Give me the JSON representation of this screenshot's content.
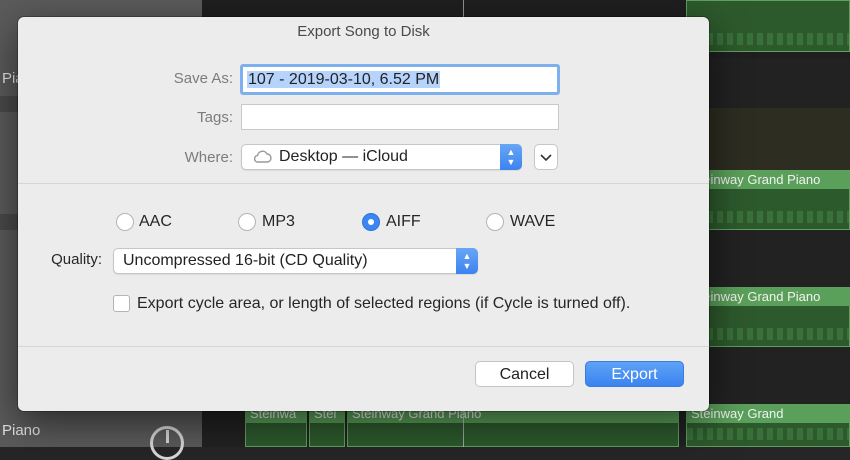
{
  "dialog": {
    "title": "Export Song to Disk",
    "save_as_label": "Save As:",
    "save_as_value": "107 - 2019-03-10, 6.52 PM",
    "tags_label": "Tags:",
    "tags_value": "",
    "where_label": "Where:",
    "where_value": "Desktop — iCloud",
    "formats": [
      {
        "label": "AAC",
        "selected": false
      },
      {
        "label": "MP3",
        "selected": false
      },
      {
        "label": "AIFF",
        "selected": true
      },
      {
        "label": "WAVE",
        "selected": false
      }
    ],
    "quality_label": "Quality:",
    "quality_value": "Uncompressed 16-bit (CD Quality)",
    "cycle_checkbox_label": "Export cycle area, or length of selected regions (if Cycle is turned off).",
    "cancel_label": "Cancel",
    "export_label": "Export",
    "accent_color": "#3b86f2"
  },
  "background": {
    "left_labels": [
      "Pia",
      "Piano"
    ],
    "region_labels": [
      "Steinway Grand Piano",
      "Steinway Grand Piano",
      "Steinway Grand",
      "Steinwa",
      "Stei",
      "Steinway Grand Piano"
    ]
  }
}
